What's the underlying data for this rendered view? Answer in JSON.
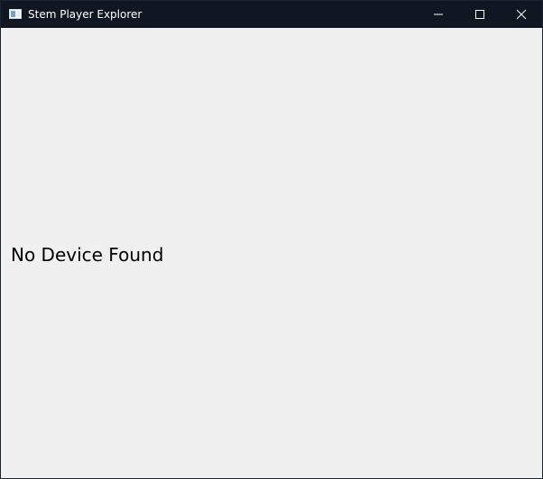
{
  "window": {
    "title": "Stem Player Explorer"
  },
  "content": {
    "status_text": "No Device Found"
  }
}
